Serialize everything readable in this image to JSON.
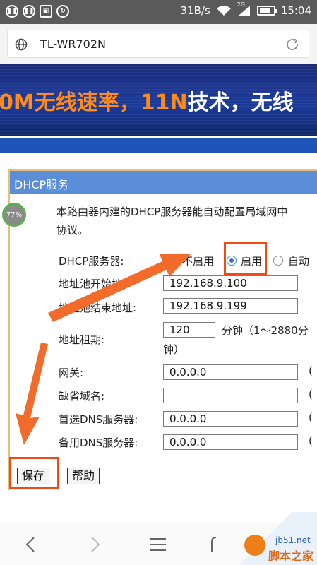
{
  "status_bar": {
    "speed": "31B/s",
    "signal_tag": "2G",
    "time": "15:04"
  },
  "address_bar": {
    "url": "TL-WR702N"
  },
  "banner": {
    "part1": "0M无线速率，",
    "part2": "11N",
    "part3": "技术，无线"
  },
  "panel": {
    "title": "DHCP服务",
    "progress_badge": "77%",
    "description_line1": "本路由器内建的DHCP服务器能自动配置局域网中",
    "description_line2": "协议。"
  },
  "form": {
    "dhcp_server_label": "DHCP服务器:",
    "options": [
      {
        "label": "不启用",
        "checked": false
      },
      {
        "label": "启用",
        "checked": true
      },
      {
        "label": "自动",
        "checked": false
      }
    ],
    "pool_start_label": "地址池开始地",
    "pool_start_value": "192.168.9.100",
    "pool_end_label": "地址池结束地址:",
    "pool_end_value": "192.168.9.199",
    "lease_label": "地址租期:",
    "lease_value": "120",
    "lease_unit": "分钟（1～2880分",
    "lease_unit_cont": "钟）",
    "gateway_label": "网关:",
    "gateway_value": "0.0.0.0",
    "domain_label": "缺省域名:",
    "domain_value": "",
    "dns1_label": "首选DNS服务器:",
    "dns1_value": "0.0.0.0",
    "dns2_label": "备用DNS服务器:",
    "dns2_value": "0.0.0.0",
    "optional_mark": "(",
    "save_label": "保存",
    "help_label": "帮助"
  },
  "watermark": {
    "url": "jb51.net",
    "name": "脚本之家"
  },
  "colors": {
    "panel_header": "#5b8ed8",
    "highlight": "#f04a18",
    "arrow": "#f36b2a",
    "banner": "#1d3893"
  }
}
